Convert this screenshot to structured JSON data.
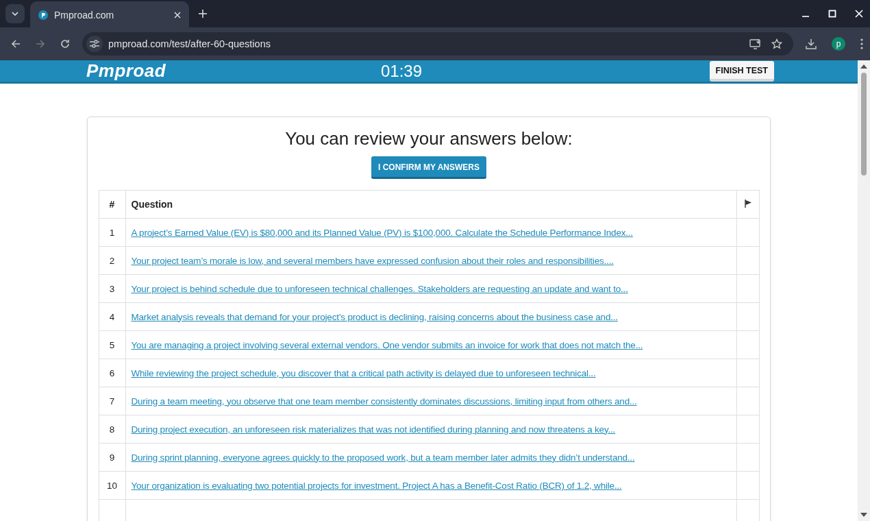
{
  "browser": {
    "tab_title": "Pmproad.com",
    "url": "pmproad.com/test/after-60-questions",
    "profile_initial": "p"
  },
  "header": {
    "logo": "Pmproad",
    "timer": "01:39",
    "finish_button": "FINISH TEST"
  },
  "review": {
    "heading": "You can review your answers below:",
    "confirm_button": "I CONFIRM MY ANSWERS"
  },
  "table": {
    "columns": [
      "#",
      "Question"
    ],
    "rows": [
      {
        "number": "1",
        "question": "A project’s Earned Value (EV) is $80,000 and its Planned Value (PV) is $100,000. Calculate the Schedule Performance Index..."
      },
      {
        "number": "2",
        "question": "Your project team’s morale is low, and several members have expressed confusion about their roles and responsibilities...."
      },
      {
        "number": "3",
        "question": "Your project is behind schedule due to unforeseen technical challenges. Stakeholders are requesting an update and want to..."
      },
      {
        "number": "4",
        "question": "Market analysis reveals that demand for your project’s product is declining, raising concerns about the business case and..."
      },
      {
        "number": "5",
        "question": "You are managing a project involving several external vendors. One vendor submits an invoice for work that does not match the..."
      },
      {
        "number": "6",
        "question": "While reviewing the project schedule, you discover that a critical path activity is delayed due to unforeseen technical..."
      },
      {
        "number": "7",
        "question": "During a team meeting, you observe that one team member consistently dominates discussions, limiting input from others and..."
      },
      {
        "number": "8",
        "question": "During project execution, an unforeseen risk materializes that was not identified during planning and now threatens a key..."
      },
      {
        "number": "9",
        "question": "During sprint planning, everyone agrees quickly to the proposed work, but a team member later admits they didn’t understand..."
      },
      {
        "number": "10",
        "question": "Your organization is evaluating two potential projects for investment. Project A has a Benefit-Cost Ratio (BCR) of 1.2, while..."
      }
    ]
  }
}
